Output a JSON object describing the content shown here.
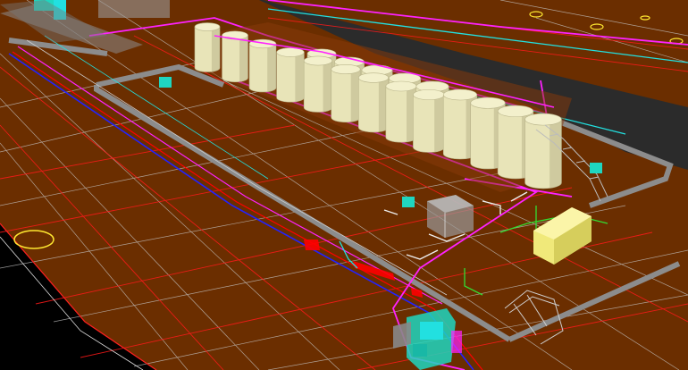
{
  "colors": {
    "background": "#000000",
    "ground": "#6b2e00",
    "grid_white": "#c8c8c8",
    "grid_red": "#ff1a1a",
    "road": "#8c8c8c",
    "asphalt": "#2b2b2b",
    "tank_fill": "#e8e4b8",
    "tank_shade": "#b9b48a",
    "pipe_magenta": "#ff22ff",
    "pipe_blue": "#2222ff",
    "pipe_red": "#ff0000",
    "pipe_green": "#33dd33",
    "pipe_cyan": "#22e0e0",
    "equipment_teal": "#1fd6c0",
    "equipment_grey": "#9a9a9a",
    "building_yellow": "#f0e97a",
    "marker_yellow": "#ffe830"
  },
  "scene": {
    "tank_count": 18,
    "icons": [
      "tank-farm",
      "pipe-rack",
      "stair-tower",
      "pump-skid",
      "control-building"
    ]
  }
}
